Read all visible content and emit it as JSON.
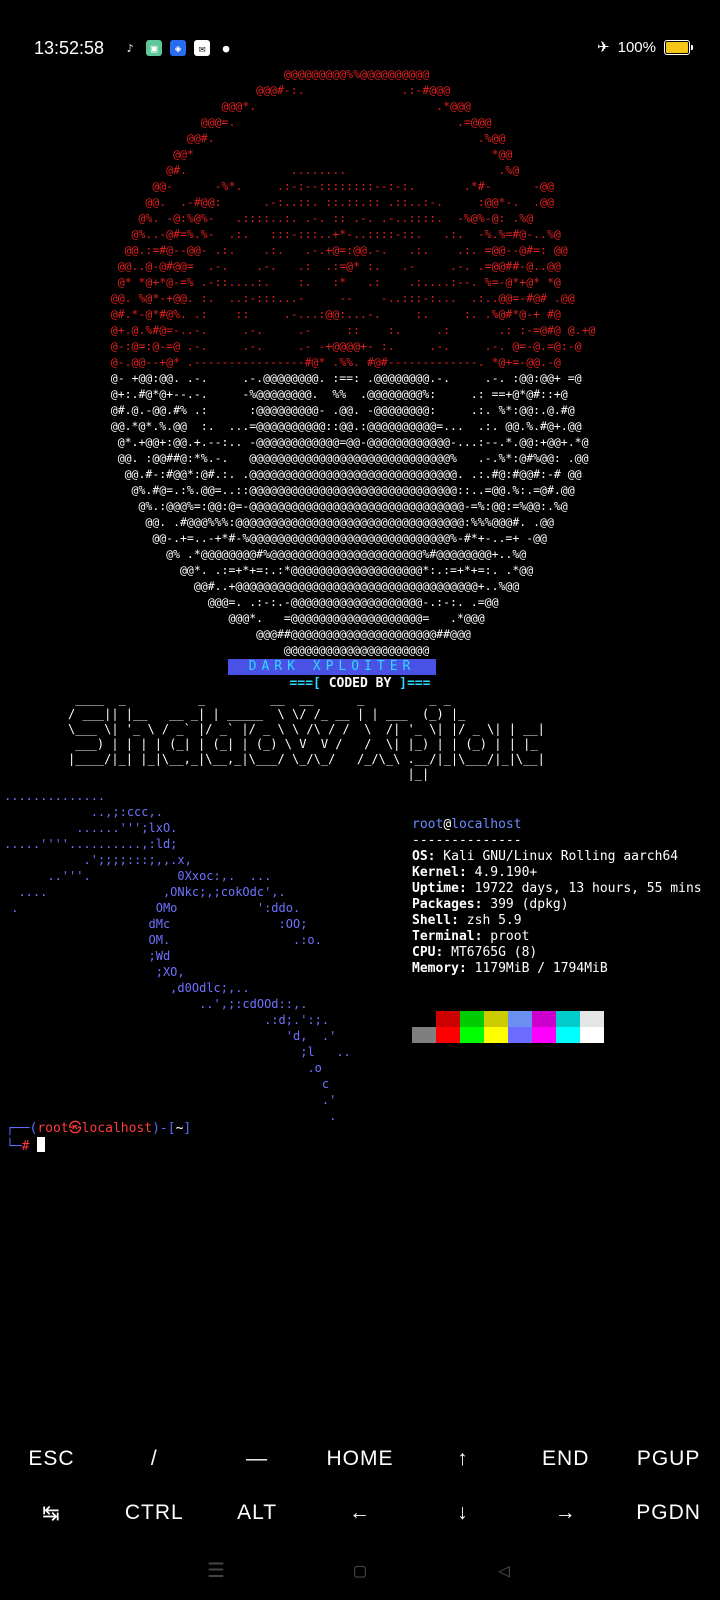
{
  "status": {
    "time": "13:52:58",
    "battery": "100%"
  },
  "ascii_art": {
    "red_lines": "                                         @@@@@@@@@%%@@@@@@@@@@\n                                     @@@#-:.              .:-#@@@\n                                @@@*.                          .*@@@\n                             @@@=.                                .=@@@\n                           @@#.                                      .%@@\n                         @@*                                           *@@\n                        @#.               ........                      .%@\n                      @@-      -%*.     .:-:--::::::::--:-:.       .*#-      -@@\n                     @@.  .-#@@:      .-:..::. ::.::.:: .::..:-.     :@@*-.  .@@\n                    @%. -@:%@%-   .::::..:. .-. :: .-. .-..::::.  -%@%-@: .%@\n                   @%..-@#=%.%-  .:.   :::-:::..+*-..::::-::.   .:.  -%.%=#@-..%@\n                  @@.:=#@--@@- .:.    .:.   .-.+@=:@@.-.   .:.    .:. =@@--@#=: @@\n                 @@..@-@#@@=  .-.    .-.   .:  .:=@* :.   .-     .-. .=@@##-@..@@\n                 @* *@+*@-=% .-::....:.    :.   :*   .:    .:....:--. %=-@*+@* *@\n                @@. %@*-+@@. :.  ..:-:::...-     --    -..:::-:...  .:..@@=-#@# .@@\n                @#.*-@*#@%. .:    ::     .-...:@@:...-.     :.     :. .%@#*@-+ #@\n                @+.@.%#@=-..-.     .-.     .-     ::    :.     .:       .: :-=@#@ @.+@\n                @-:@=:@-=@ .-.     .-.     .- -+@@@@+- :.     .-.     .-. @=-@.=@:-@\n                @-.@@--+@* .----------------#@* .%%. #@#-------------. *@+=-@@.-@",
    "white_lines": "                @- +@@:@@. .-.     .-.@@@@@@@@. :==: .@@@@@@@@.-.     .-. :@@:@@+ =@\n                @+:.#@*@+--.-.     -%@@@@@@@@.  %%  .@@@@@@@@%:     .: ==+@*@#::+@\n                @#.@.-@@.#% .:      :@@@@@@@@@- .@@. -@@@@@@@@:     .:. %*:@@:.@.#@\n                @@.*@*.%.@@  :.  ...=@@@@@@@@@@::@@.:@@@@@@@@@@=...  .:. @@.%.#@+.@@\n                 @*.+@@+:@@.+.--:.. -@@@@@@@@@@@@=@@-@@@@@@@@@@@@-...:--.*.@@:+@@+.*@\n                 @@. :@@##@:*%.-.   @@@@@@@@@@@@@@@@@@@@@@@@@@@@@%   .-.%*:@#%@@: .@@\n                  @@.#-:#@@*:@#.:. .@@@@@@@@@@@@@@@@@@@@@@@@@@@@@@. .:.#@:#@@#:-# @@\n                   @%.#@=.:%.@@=..::@@@@@@@@@@@@@@@@@@@@@@@@@@@@@@::..=@@.%:.=@#.@@\n                    @%.:@@@%=:@@:@=-@@@@@@@@@@@@@@@@@@@@@@@@@@@@@@@-=%:@@:=%@@:.%@\n                     @@. .#@@@%%%:@@@@@@@@@@@@@@@@@@@@@@@@@@@@@@@@@:%%%@@@#. .@@\n                      @@-.+=..-+*#-%@@@@@@@@@@@@@@@@@@@@@@@@@@@@@%-#*+-..=+ -@@\n                        @% .*@@@@@@@@#%@@@@@@@@@@@@@@@@@@@@@@%#@@@@@@@@+..%@\n                          @@*. .:=+*+=:.:*@@@@@@@@@@@@@@@@@@@*:.:=+*+=:. .*@@\n                            @@#..+@@@@@@@@@@@@@@@@@@@@@@@@@@@@@@@@@@@+..%@@\n                              @@@=. .:-:.-@@@@@@@@@@@@@@@@@@@-.:-:. .=@@\n                                 @@@*.   =@@@@@@@@@@@@@@@@@@@=   .*@@@\n                                     @@@##@@@@@@@@@@@@@@@@@@@@@##@@@\n                                         @@@@@@@@@@@@@@@@@@@@@"
  },
  "banner": {
    "title": "DARK XPLOITER",
    "coded_left": "===[ ",
    "coded_mid": "CODED BY",
    "coded_right": " ]==="
  },
  "bigtext": {
    "lines": " ____  _          _         __  __      _         _ _\n/ ___|| |__   __ _| | _____  \\ \\/ /_ __ | | ___  (_) |_\n\\___ \\| '_ \\ / _` |/ _` |/ _ \\ \\ /\\ / /  \\  /| '_ \\| |/ _ \\| | __|\n ___) | | | | (_| | (_| | (_) \\ V  V /   /  \\| |_) | | (_) | | |_\n|____/|_| |_|\\__,_|\\__,_|\\___/ \\_/\\_/   /_/\\_\\ .__/|_|\\___/|_|\\__|\n                                               |_|"
  },
  "neofetch": {
    "logo": "..............\n            ..,;:ccc,.\n          ......''';lxO.\n.....''''..........,:ld;\n           .';;;;:::;,,.x,\n      ..'''.            0Xxoc:,.  ...\n  ....                ,ONkc;,;cokOdc',.\n .                   OMo           ':ddo.\n                    dMc               :OO;\n                    OM.                 .:o.\n                    ;Wd\n                     ;XO,\n                       ,d0Odlc;,..\n                           ..',;:cdOOd::,.\n                                    .:d;.':;.\n                                       'd,  .'\n                                         ;l   ..\n                                          .o\n                                            c\n                                            .'\n                                             .",
    "user": "root",
    "at": "@",
    "host": "localhost",
    "separator": "--------------",
    "fields": [
      {
        "key": "OS:",
        "value": " Kali GNU/Linux Rolling aarch64"
      },
      {
        "key": "Kernel:",
        "value": " 4.9.190+"
      },
      {
        "key": "Uptime:",
        "value": " 19722 days, 13 hours, 55 mins"
      },
      {
        "key": "Packages:",
        "value": " 399 (dpkg)"
      },
      {
        "key": "Shell:",
        "value": " zsh 5.9"
      },
      {
        "key": "Terminal:",
        "value": " proot"
      },
      {
        "key": "CPU:",
        "value": " MT6765G (8)"
      },
      {
        "key": "Memory:",
        "value": " 1179MiB / 1794MiB"
      }
    ],
    "palette_top": [
      "#000000",
      "#cc0000",
      "#00cc00",
      "#cccc00",
      "#6a8ff0",
      "#cc00cc",
      "#00cccc",
      "#e5e5e5"
    ],
    "palette_bottom": [
      "#7f7f7f",
      "#ff0000",
      "#00ff00",
      "#ffff00",
      "#6b6bff",
      "#ff00ff",
      "#00ffff",
      "#ffffff"
    ]
  },
  "prompt": {
    "line1_prefix": "┌──(",
    "user": "root",
    "skull": "㉿",
    "host": "localhost",
    "mid": ")-[",
    "dir": "~",
    "end": "]",
    "line2_prefix": "└─",
    "hash": "#"
  },
  "extra_keys": {
    "row1": [
      "ESC",
      "/",
      "—",
      "HOME",
      "↑",
      "END",
      "PGUP"
    ],
    "row2": [
      "↹",
      "CTRL",
      "ALT",
      "←",
      "↓",
      "→",
      "PGDN"
    ]
  },
  "navbar": {
    "icons": [
      "menu-icon",
      "home-square-icon",
      "back-triangle-icon"
    ]
  }
}
